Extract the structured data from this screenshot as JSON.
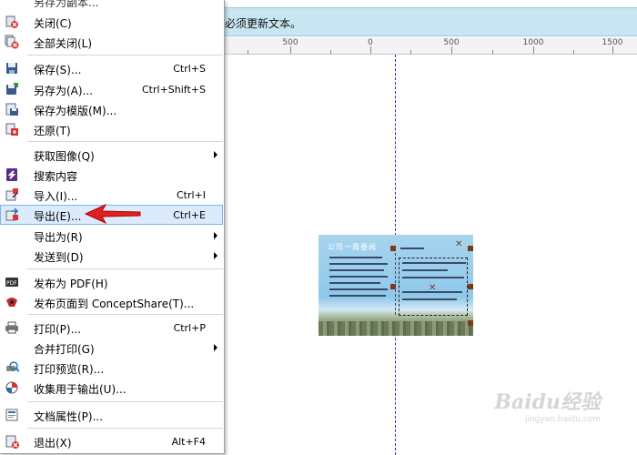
{
  "notice": {
    "text": "必须更新文本。"
  },
  "ruler": {
    "labels": [
      "500",
      "0",
      "500",
      "1000",
      "1500"
    ]
  },
  "design": {
    "title": "公司一周要闻"
  },
  "watermark": {
    "logo": "Baidu经验",
    "url": "jingyan.baidu.com"
  },
  "menu": {
    "partial_top": "另存为副本...",
    "items": {
      "close": {
        "label": "关闭(C)",
        "icon": "close-doc-icon"
      },
      "close_all": {
        "label": "全部关闭(L)",
        "icon": "close-all-icon"
      },
      "save": {
        "label": "保存(S)...",
        "shortcut": "Ctrl+S",
        "icon": "save-icon"
      },
      "save_as": {
        "label": "另存为(A)...",
        "shortcut": "Ctrl+Shift+S",
        "icon": "save-as-icon"
      },
      "save_template": {
        "label": "保存为模版(M)...",
        "icon": "save-template-icon"
      },
      "revert": {
        "label": "还原(T)",
        "icon": "revert-icon"
      },
      "acquire": {
        "label": "获取图像(Q)",
        "icon": "scanner-icon"
      },
      "search": {
        "label": "搜索内容",
        "icon": "search-content-icon"
      },
      "import": {
        "label": "导入(I)...",
        "shortcut": "Ctrl+I",
        "icon": "import-icon"
      },
      "export": {
        "label": "导出(E)...",
        "shortcut": "Ctrl+E",
        "icon": "export-icon"
      },
      "export_for": {
        "label": "导出为(R)"
      },
      "send_to": {
        "label": "发送到(D)"
      },
      "publish_pdf": {
        "label": "发布为 PDF(H)",
        "icon": "pdf-icon"
      },
      "publish_cs": {
        "label": "发布页面到 ConceptShare(T)...",
        "icon": "conceptshare-icon"
      },
      "print": {
        "label": "打印(P)...",
        "shortcut": "Ctrl+P",
        "icon": "printer-icon"
      },
      "merge_print": {
        "label": "合并打印(G)"
      },
      "print_preview": {
        "label": "打印预览(R)...",
        "icon": "print-preview-icon"
      },
      "collect": {
        "label": "收集用于输出(U)...",
        "icon": "collect-output-icon"
      },
      "doc_props": {
        "label": "文档属性(P)...",
        "icon": "document-properties-icon"
      },
      "exit": {
        "label": "退出(X)",
        "shortcut": "Alt+F4",
        "icon": "exit-icon"
      }
    }
  }
}
